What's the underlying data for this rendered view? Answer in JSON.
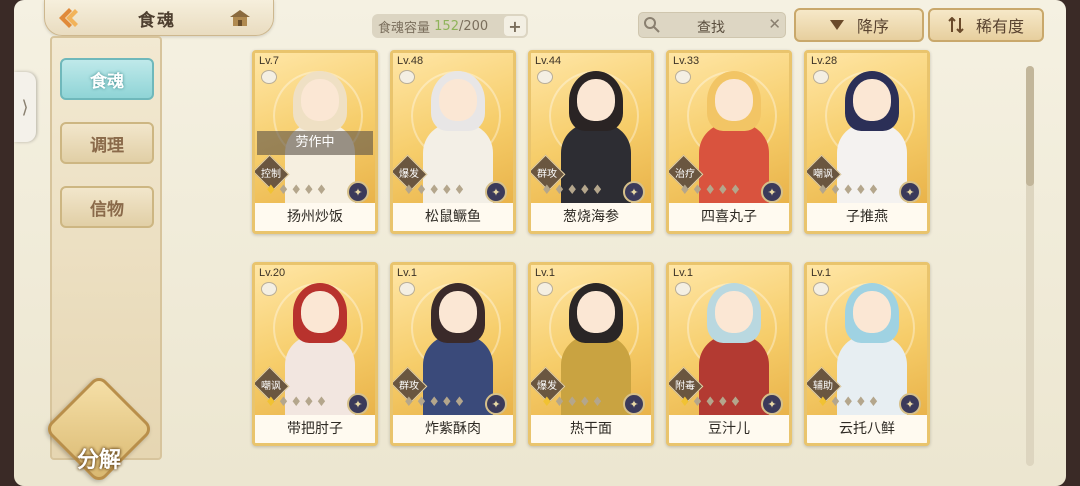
{
  "header": {
    "title": "食魂",
    "capacity_label": "食魂容量",
    "capacity_current": "152",
    "capacity_total": "/200",
    "search_label": "查找",
    "sort_order_label": "降序",
    "sort_by_label": "稀有度"
  },
  "sidebar": {
    "tabs": [
      {
        "label": "食魂",
        "active": true
      },
      {
        "label": "调理",
        "active": false
      },
      {
        "label": "信物",
        "active": false
      }
    ],
    "decompose_label": "分解"
  },
  "cards": [
    {
      "level": "Lv.7",
      "name": "扬州炒饭",
      "role": "控制",
      "stars": 1,
      "status": "劳作中",
      "hair": "#efe0c4",
      "outfit": "#f6efe0"
    },
    {
      "level": "Lv.48",
      "name": "松鼠鳜鱼",
      "role": "爆发",
      "stars": 0,
      "status": "",
      "hair": "#e8e6e6",
      "outfit": "#f3efe6"
    },
    {
      "level": "Lv.44",
      "name": "葱烧海参",
      "role": "群攻",
      "stars": 0,
      "status": "",
      "hair": "#2a2424",
      "outfit": "#2d2d33"
    },
    {
      "level": "Lv.33",
      "name": "四喜丸子",
      "role": "治疗",
      "stars": 0,
      "status": "",
      "hair": "#f2c565",
      "outfit": "#d9533e"
    },
    {
      "level": "Lv.28",
      "name": "子推燕",
      "role": "嘲讽",
      "stars": 0,
      "status": "",
      "hair": "#2b2f57",
      "outfit": "#f4f2f0"
    },
    {
      "level": "Lv.20",
      "name": "带把肘子",
      "role": "嘲讽",
      "stars": 1,
      "status": "",
      "hair": "#b8322d",
      "outfit": "#f2e6e0"
    },
    {
      "level": "Lv.1",
      "name": "炸紫酥肉",
      "role": "群攻",
      "stars": 0,
      "status": "",
      "hair": "#3a2a2a",
      "outfit": "#3a4a7a"
    },
    {
      "level": "Lv.1",
      "name": "热干面",
      "role": "爆发",
      "stars": 1,
      "status": "",
      "hair": "#2a2626",
      "outfit": "#c9a341"
    },
    {
      "level": "Lv.1",
      "name": "豆汁儿",
      "role": "附毒",
      "stars": 1,
      "status": "",
      "hair": "#b9d8e0",
      "outfit": "#b33a32"
    },
    {
      "level": "Lv.1",
      "name": "云托八鲜",
      "role": "辅助",
      "stars": 1,
      "status": "",
      "hair": "#9fd2e2",
      "outfit": "#e7eef2"
    }
  ],
  "colors": {
    "accent_gold": "#e9c46d",
    "active_tab": "#8fd4d6",
    "capacity_current": "#8fb35a"
  }
}
